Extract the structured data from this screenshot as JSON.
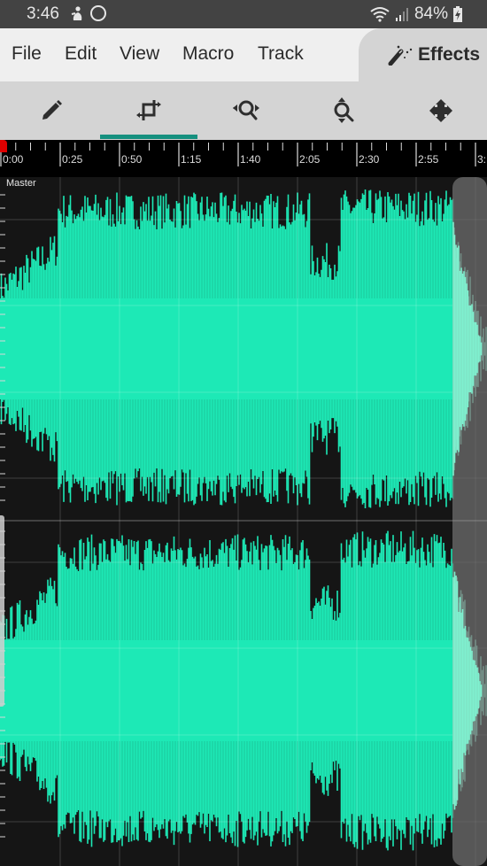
{
  "status_bar": {
    "time": "3:46",
    "left_icons": [
      "notification-figure-icon",
      "circle-icon"
    ],
    "right_icons": [
      "wifi-icon",
      "signal-icon"
    ],
    "battery_percent": "84%",
    "battery_icon": "battery-charging-icon"
  },
  "menu": {
    "items": [
      {
        "label": "File"
      },
      {
        "label": "Edit"
      },
      {
        "label": "View"
      },
      {
        "label": "Macro"
      },
      {
        "label": "Track"
      }
    ],
    "effects": {
      "label": "Effects",
      "icon": "magic-wand-icon"
    }
  },
  "toolbar": {
    "tools": [
      {
        "name": "draw",
        "icon": "pencil-icon",
        "active": false
      },
      {
        "name": "crop",
        "icon": "crop-icon",
        "active": true
      },
      {
        "name": "zoom-horizontal",
        "icon": "zoom-horizontal-icon",
        "active": false
      },
      {
        "name": "zoom-vertical",
        "icon": "zoom-vertical-icon",
        "active": false
      },
      {
        "name": "move",
        "icon": "move-icon",
        "active": false
      }
    ],
    "accent_color": "#15907f"
  },
  "timeline": {
    "labels": [
      "0:00",
      "0:25",
      "0:50",
      "1:15",
      "1:40",
      "2:05",
      "2:30",
      "2:55",
      "3:"
    ],
    "playhead_color": "#e00000"
  },
  "track": {
    "name": "Master",
    "channels": 2,
    "waveform_color": "#1de9b6",
    "selected_region_color": "#7ff0cf",
    "background_color": "#151515"
  }
}
